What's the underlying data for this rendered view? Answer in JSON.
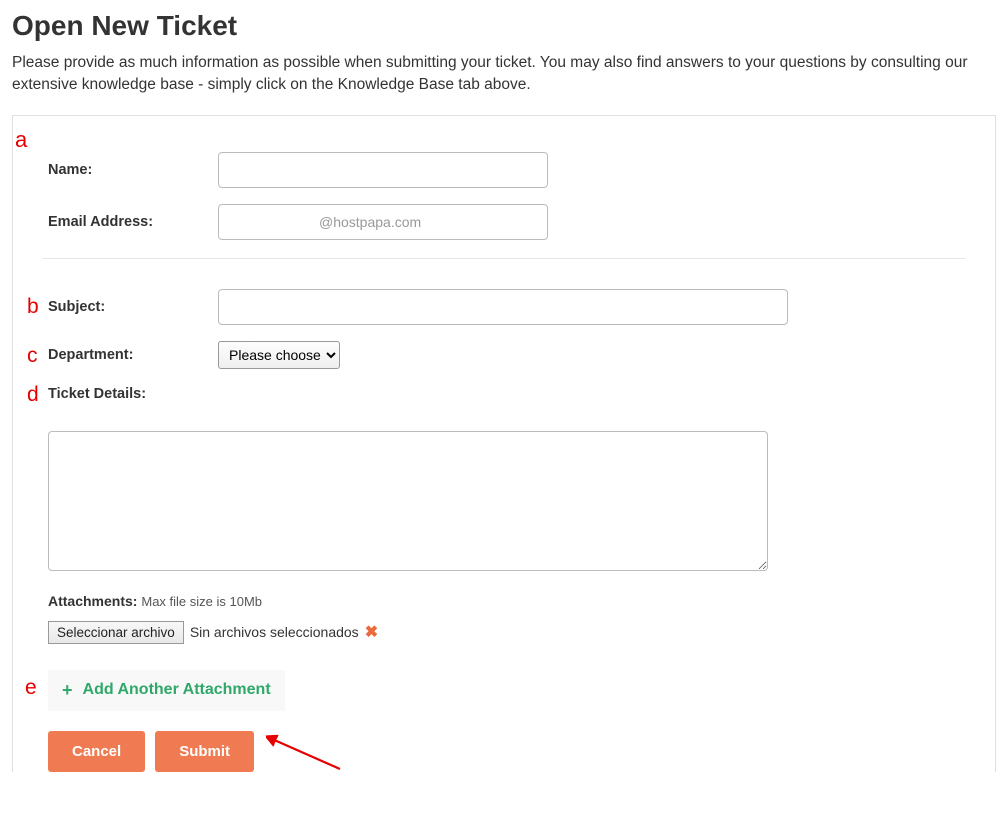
{
  "page": {
    "title": "Open New Ticket",
    "intro": "Please provide as much information as possible when submitting your ticket. You may also find answers to your questions by consulting our extensive knowledge base - simply click on the Knowledge Base tab above."
  },
  "annotations": {
    "a": "a",
    "b": "b",
    "c": "c",
    "d": "d",
    "e": "e"
  },
  "form": {
    "name_label": "Name:",
    "name_value": "",
    "email_label": "Email Address:",
    "email_value": "@hostpapa.com",
    "subject_label": "Subject:",
    "subject_value": "",
    "department_label": "Department:",
    "department_placeholder": "Please choose",
    "details_label": "Ticket Details:",
    "details_value": "",
    "attachments_label": "Attachments:",
    "attachments_hint": "Max file size is 10Mb",
    "file_button": "Seleccionar archivo",
    "file_status": "Sin archivos seleccionados",
    "add_attachment_label": "Add Another Attachment",
    "cancel_label": "Cancel",
    "submit_label": "Submit"
  }
}
